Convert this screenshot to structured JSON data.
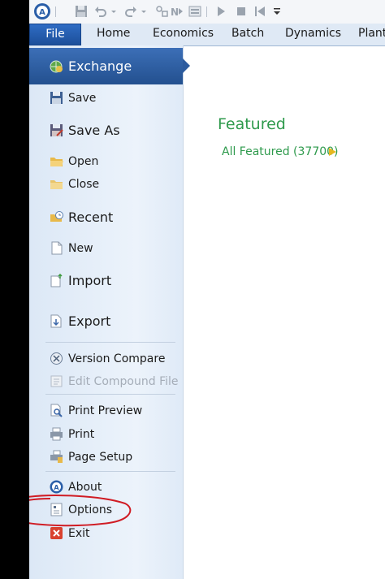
{
  "ribbon": {
    "tabs": [
      "File",
      "Home",
      "Economics",
      "Batch",
      "Dynamics",
      "Plant"
    ]
  },
  "backstage": {
    "exchange_label": "Exchange",
    "items": {
      "save": "Save",
      "save_as": "Save As",
      "open": "Open",
      "close": "Close",
      "recent": "Recent",
      "new": "New",
      "import": "Import",
      "export": "Export",
      "version_compare": "Version Compare",
      "edit_compound_file": "Edit Compound File",
      "print_preview": "Print Preview",
      "print": "Print",
      "page_setup": "Page Setup",
      "about": "About",
      "options": "Options",
      "exit": "Exit"
    }
  },
  "main": {
    "featured_title": "Featured",
    "featured_link": "All Featured (37700)"
  },
  "colors": {
    "accent_blue": "#2c5b9e",
    "featured_green": "#2e9a4c",
    "annotation_red": "#d01c24"
  }
}
